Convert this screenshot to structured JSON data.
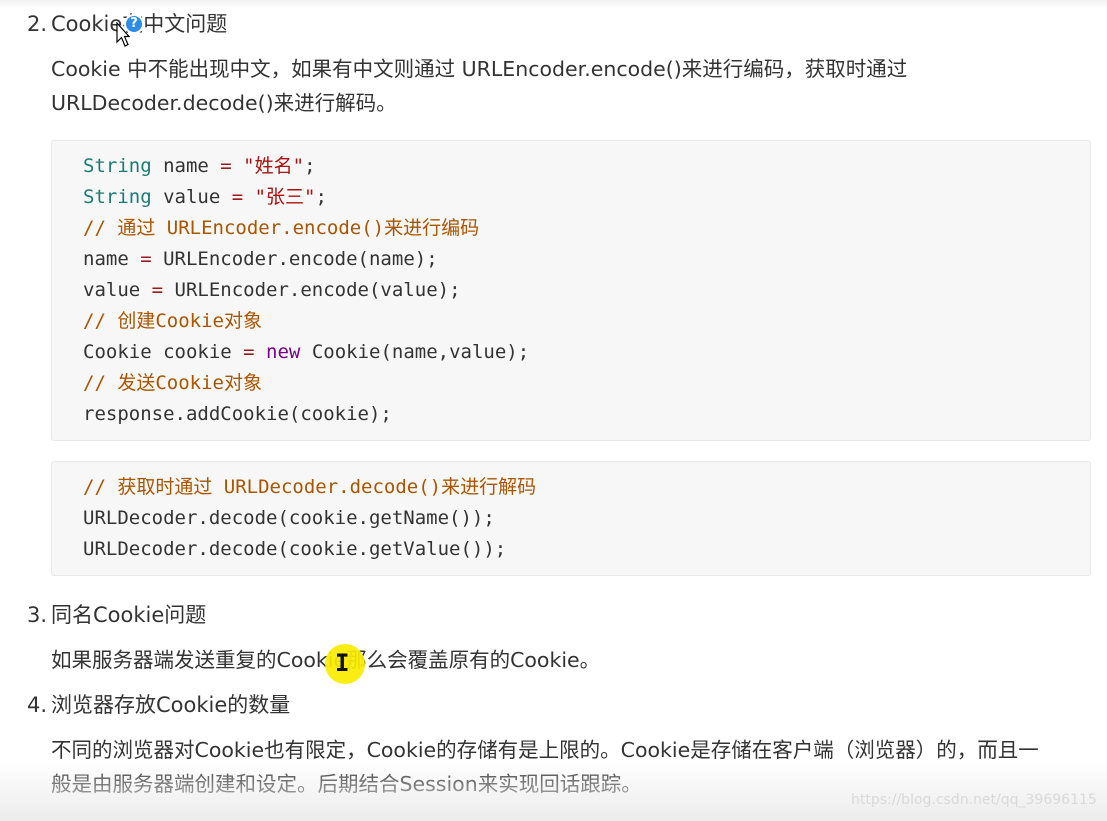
{
  "sections": {
    "s2": {
      "number": "2.",
      "title": "Cookie在中文问题",
      "para": [
        "Cookie 中不能出现中文，如果有中文则通过 URLEncoder.encode()来进行编码，获取时通过",
        "URLDecoder.decode()来进行解码。"
      ]
    },
    "s3": {
      "number": "3.",
      "title": "同名Cookie问题",
      "para": [
        "如果服务器端发送重复的Cookie那么会覆盖原有的Cookie。"
      ]
    },
    "s4": {
      "number": "4.",
      "title": "浏览器存放Cookie的数量",
      "para": [
        "不同的浏览器对Cookie也有限定，Cookie的存储有是上限的。Cookie是存储在客户端（浏览器）的，而且一",
        "般是由服务器端创建和设定。后期结合Session来实现回话跟踪。"
      ]
    }
  },
  "code1": {
    "l1": {
      "type": "String",
      "rest": " name ",
      "op": "=",
      "str": " \"姓名\"",
      "end": ";"
    },
    "l2": {
      "type": "String",
      "rest": " value ",
      "op": "=",
      "str": " \"张三\"",
      "end": ";"
    },
    "l3": "// 通过 URLEncoder.encode()来进行编码",
    "l4": {
      "a": "name ",
      "op": "=",
      "b": " URLEncoder.encode(name);"
    },
    "l5": {
      "a": "value ",
      "op": "=",
      "b": " URLEncoder.encode(value);"
    },
    "l6": "// 创建Cookie对象",
    "l7": {
      "a": "Cookie cookie ",
      "op": "=",
      "kw": " new",
      "b": " Cookie(name,value);"
    },
    "l8": "// 发送Cookie对象",
    "l9": "response.addCookie(cookie);"
  },
  "code2": {
    "l1": "// 获取时通过 URLDecoder.decode()来进行解码",
    "l2": "URLDecoder.decode(cookie.getName());",
    "l3": "URLDecoder.decode(cookie.getValue());"
  },
  "overlay": {
    "help_glyph": "?",
    "ibeam_glyph": "I"
  },
  "watermark": "https://blog.csdn.net/qq_39696115",
  "colors": {
    "help_badge": "#2b8de6",
    "cursor_highlight": "#f8eb00",
    "code_type": "#1b7b73",
    "code_keyword": "#770088",
    "code_string": "#aa1111",
    "code_comment": "#aa5500"
  }
}
